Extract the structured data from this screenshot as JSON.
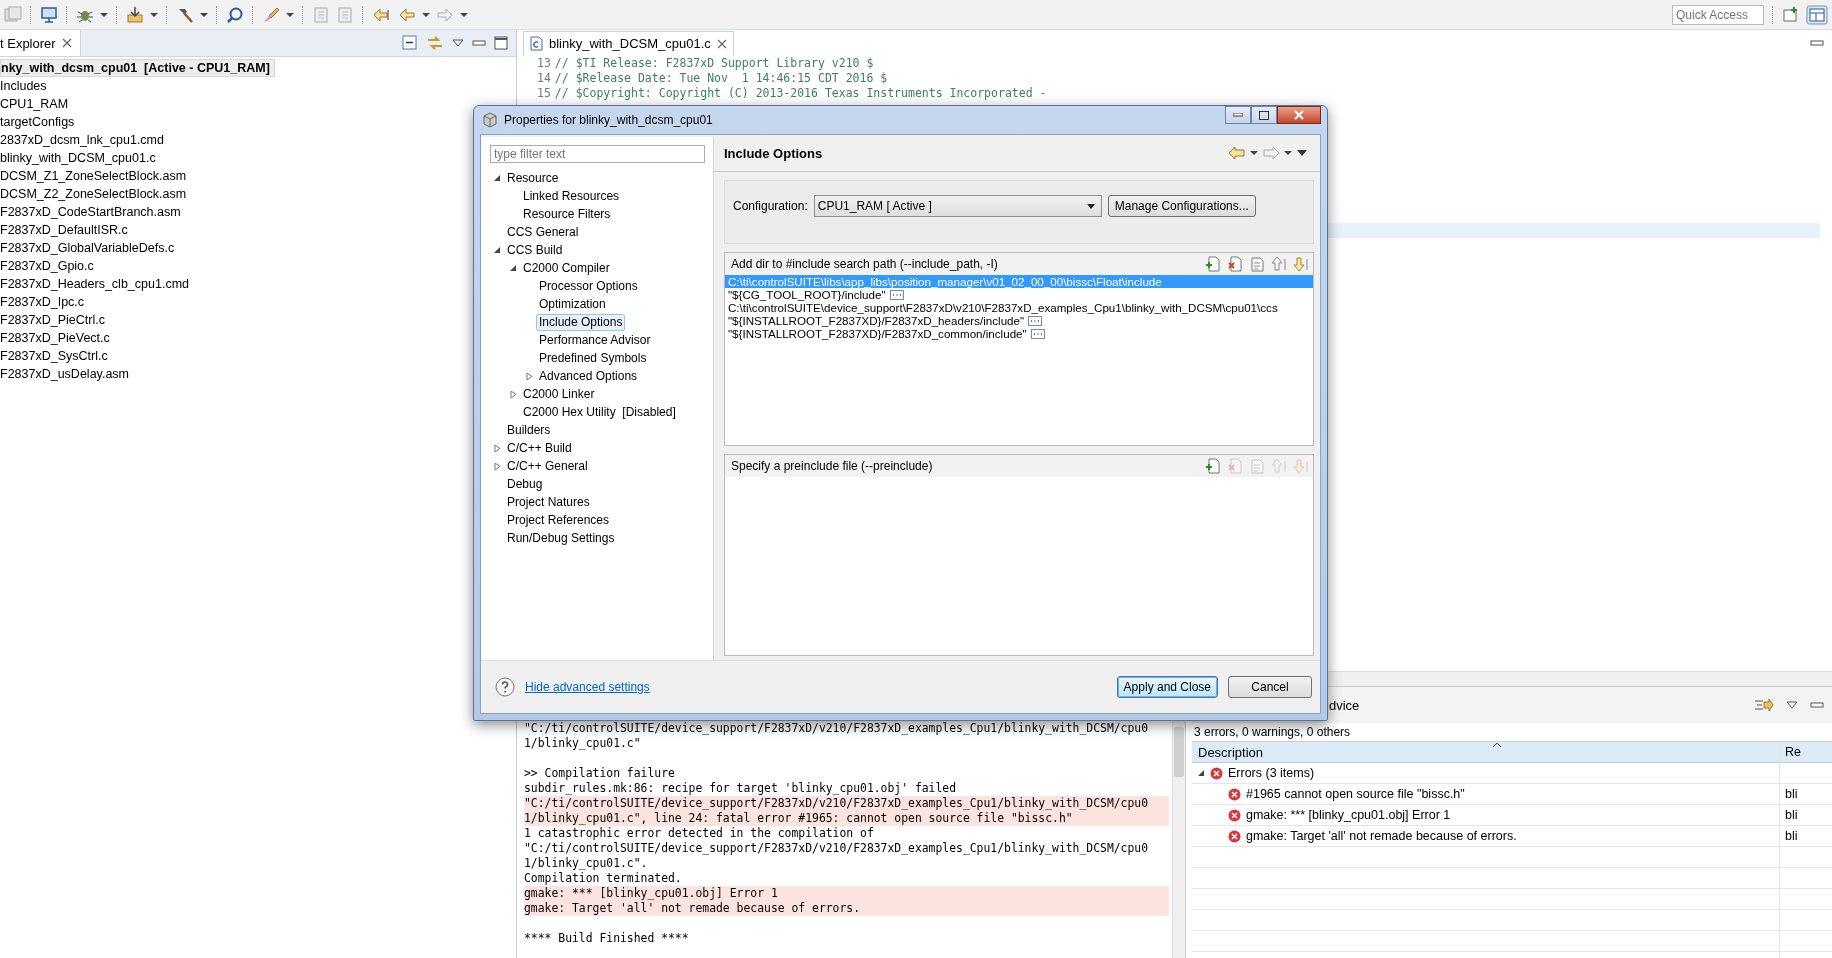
{
  "toolbar": {
    "quick_access": {
      "placeholder": "Quick Access"
    }
  },
  "explorer": {
    "tab": "t Explorer",
    "tree": [
      {
        "label": "nky_with_dcsm_cpu01  [Active - CPU1_RAM]",
        "selected": true,
        "children": [
          {
            "label": "Includes",
            "selected": false
          },
          {
            "label": "CPU1_RAM",
            "selected": false
          },
          {
            "label": "targetConfigs",
            "selected": false
          },
          {
            "label": "2837xD_dcsm_lnk_cpu1.cmd",
            "selected": false
          },
          {
            "label": "blinky_with_DCSM_cpu01.c",
            "selected": false
          },
          {
            "label": "DCSM_Z1_ZoneSelectBlock.asm",
            "selected": false
          },
          {
            "label": "DCSM_Z2_ZoneSelectBlock.asm",
            "selected": false
          },
          {
            "label": "F2837xD_CodeStartBranch.asm",
            "selected": false
          },
          {
            "label": "F2837xD_DefaultISR.c",
            "selected": false
          },
          {
            "label": "F2837xD_GlobalVariableDefs.c",
            "selected": false
          },
          {
            "label": "F2837xD_Gpio.c",
            "selected": false
          },
          {
            "label": "F2837xD_Headers_clb_cpu1.cmd",
            "selected": false
          },
          {
            "label": "F2837xD_Ipc.c",
            "selected": false
          },
          {
            "label": "F2837xD_PieCtrl.c",
            "selected": false
          },
          {
            "label": "F2837xD_PieVect.c",
            "selected": false
          },
          {
            "label": "F2837xD_SysCtrl.c",
            "selected": false
          },
          {
            "label": "F2837xD_usDelay.asm",
            "selected": false
          }
        ]
      }
    ]
  },
  "editor": {
    "tab": "blinky_with_DCSM_cpu01.c",
    "lines": [
      {
        "number": "13",
        "code": "// $TI Release: F2837xD Support Library v210 $"
      },
      {
        "number": "14",
        "code": "// $Release Date: Tue Nov  1 14:46:15 CDT 2016 $"
      },
      {
        "number": "15",
        "code": "// $Copyright: Copyright (C) 2013-2016 Texas Instruments Incorporated -"
      }
    ]
  },
  "console": {
    "lines": [
      {
        "text": "\"C:/ti/controlSUITE/device_support/F2837xD/v210/F2837xD_examples_Cpu1/blinky_with_DCSM/cpu0",
        "error": false,
        "space_before": false
      },
      {
        "text": "1/blinky_cpu01.c\"",
        "error": false,
        "space_before": false
      },
      {
        "text": ">> Compilation failure",
        "error": false,
        "space_before": true
      },
      {
        "text": "subdir_rules.mk:86: recipe for target 'blinky_cpu01.obj' failed",
        "error": false,
        "space_before": false
      },
      {
        "text": "\"C:/ti/controlSUITE/device_support/F2837xD/v210/F2837xD_examples_Cpu1/blinky_with_DCSM/cpu0",
        "error": true,
        "space_before": false
      },
      {
        "text": "1/blinky_cpu01.c\", line 24: fatal error #1965: cannot open source file \"bissc.h\"",
        "error": true,
        "space_before": false
      },
      {
        "text": "1 catastrophic error detected in the compilation of",
        "error": false,
        "space_before": false
      },
      {
        "text": "\"C:/ti/controlSUITE/device_support/F2837xD/v210/F2837xD_examples_Cpu1/blinky_with_DCSM/cpu0",
        "error": false,
        "space_before": false
      },
      {
        "text": "1/blinky_cpu01.c\".",
        "error": false,
        "space_before": false
      },
      {
        "text": "Compilation terminated.",
        "error": false,
        "space_before": false
      },
      {
        "text": "gmake: *** [blinky_cpu01.obj] Error 1",
        "error": true,
        "space_before": false
      },
      {
        "text": "gmake: Target 'all' not remade because of errors.",
        "error": true,
        "space_before": false
      },
      {
        "text": "**** Build Finished ****",
        "error": false,
        "space_before": true
      }
    ]
  },
  "problems": {
    "tab": "dvice",
    "summary": "3 errors, 0 warnings, 0 others",
    "columns": [
      "Description",
      "Re"
    ],
    "groups": [
      {
        "label": "Errors (3 items)",
        "expanded": true,
        "children": [
          {
            "description": "#1965 cannot open source file \"bissc.h\"",
            "resource": "bli"
          },
          {
            "description": "gmake: *** [blinky_cpu01.obj] Error 1",
            "resource": "bli"
          },
          {
            "description": "gmake: Target 'all' not remade because of errors.",
            "resource": "bli"
          }
        ]
      }
    ]
  },
  "dialog": {
    "title": "Properties for blinky_with_dcsm_cpu01",
    "filter": {
      "placeholder": "type filter text"
    },
    "tree": [
      {
        "label": "Resource",
        "expanded": true,
        "selected": false,
        "children": [
          {
            "label": "Linked Resources",
            "selected": false
          },
          {
            "label": "Resource Filters",
            "selected": false
          }
        ]
      },
      {
        "label": "CCS General",
        "selected": false
      },
      {
        "label": "CCS Build",
        "expanded": true,
        "selected": false,
        "children": [
          {
            "label": "C2000 Compiler",
            "expanded": true,
            "selected": false,
            "children": [
              {
                "label": "Processor Options",
                "selected": false
              },
              {
                "label": "Optimization",
                "selected": false
              },
              {
                "label": "Include Options",
                "selected": true
              },
              {
                "label": "Performance Advisor",
                "selected": false
              },
              {
                "label": "Predefined Symbols",
                "selected": false
              },
              {
                "label": "Advanced Options",
                "expanded": false,
                "selected": false
              }
            ]
          },
          {
            "label": "C2000 Linker",
            "expanded": false,
            "selected": false
          },
          {
            "label": "C2000 Hex Utility  [Disabled]",
            "selected": false
          }
        ]
      },
      {
        "label": "Builders",
        "selected": false
      },
      {
        "label": "C/C++ Build",
        "expanded": false,
        "selected": false
      },
      {
        "label": "C/C++ General",
        "expanded": false,
        "selected": false
      },
      {
        "label": "Debug",
        "selected": false
      },
      {
        "label": "Project Natures",
        "selected": false
      },
      {
        "label": "Project References",
        "selected": false
      },
      {
        "label": "Run/Debug Settings",
        "selected": false
      }
    ],
    "heading": "Include Options",
    "configuration": {
      "label": "Configuration:",
      "value": "CPU1_RAM  [ Active ]",
      "button": "Manage Configurations..."
    },
    "lists": [
      {
        "title": "Add dir to #include search path (--include_path, -I)",
        "tools": [
          {
            "kind": "add",
            "disabled": false
          },
          {
            "kind": "delete",
            "disabled": false
          },
          {
            "kind": "edit",
            "disabled": false
          },
          {
            "kind": "up",
            "disabled": false
          },
          {
            "kind": "down",
            "disabled": false
          }
        ],
        "items": [
          {
            "text": "C:\\ti\\controlSUITE\\libs\\app_libs\\position_manager\\v01_02_00_00\\bissc\\Float\\include",
            "variable": false,
            "selected": true
          },
          {
            "text": "\"${CG_TOOL_ROOT}/include\"",
            "variable": true,
            "selected": false
          },
          {
            "text": "C:\\ti\\controlSUITE\\device_support\\F2837xD\\v210\\F2837xD_examples_Cpu1\\blinky_with_DCSM\\cpu01\\ccs",
            "variable": false,
            "selected": false
          },
          {
            "text": "\"${INSTALLROOT_F2837XD}/F2837xD_headers/include\"",
            "variable": true,
            "selected": false
          },
          {
            "text": "\"${INSTALLROOT_F2837XD}/F2837xD_common/include\"",
            "variable": true,
            "selected": false
          }
        ]
      },
      {
        "title": "Specify a preinclude file (--preinclude)",
        "tools": [
          {
            "kind": "add",
            "disabled": false
          },
          {
            "kind": "delete",
            "disabled": true
          },
          {
            "kind": "edit",
            "disabled": true
          },
          {
            "kind": "up",
            "disabled": true
          },
          {
            "kind": "down",
            "disabled": true
          }
        ]
      }
    ],
    "link": "Hide advanced settings",
    "buttons": [
      {
        "label": "Apply and Close",
        "default": true
      },
      {
        "label": "Cancel",
        "default": false
      }
    ]
  }
}
